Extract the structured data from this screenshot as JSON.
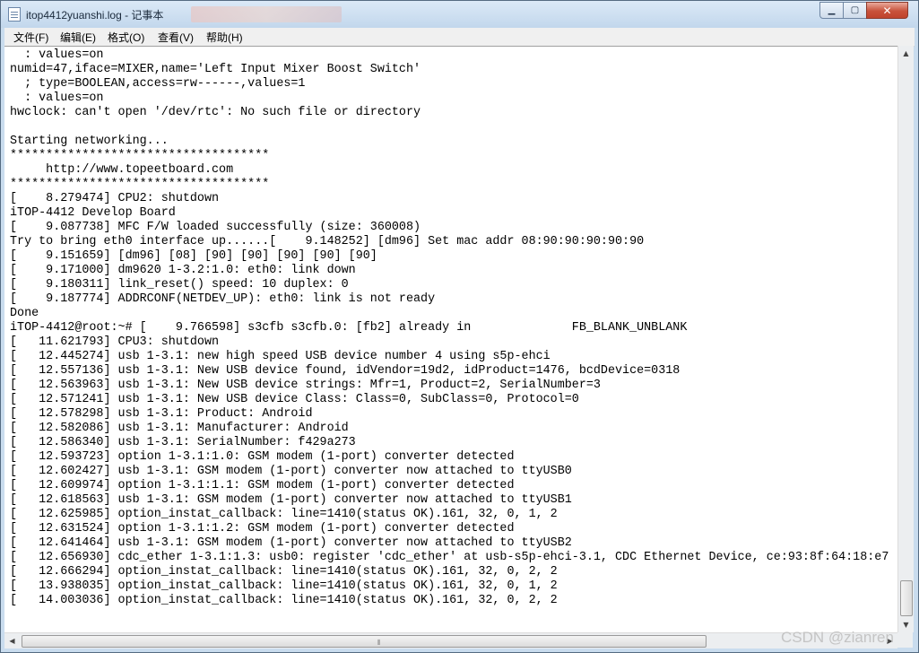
{
  "window": {
    "title": "itop4412yuanshi.log - 记事本",
    "controls": {
      "minimize": "▁",
      "maximize": "▢",
      "close": "✕"
    }
  },
  "menu": [
    {
      "label": "文件(F)"
    },
    {
      "label": "编辑(E)"
    },
    {
      "label": "格式(O)"
    },
    {
      "label": "查看(V)"
    },
    {
      "label": "帮助(H)"
    }
  ],
  "editor": {
    "lines": [
      "  : values=on",
      "numid=47,iface=MIXER,name='Left Input Mixer Boost Switch'",
      "  ; type=BOOLEAN,access=rw------,values=1",
      "  : values=on",
      "hwclock: can't open '/dev/rtc': No such file or directory",
      "",
      "Starting networking...",
      "************************************",
      "     http://www.topeetboard.com",
      "************************************",
      "[    8.279474] CPU2: shutdown",
      "iTOP-4412 Develop Board",
      "[    9.087738] MFC F/W loaded successfully (size: 360008)",
      "Try to bring eth0 interface up......[    9.148252] [dm96] Set mac addr 08:90:90:90:90:90",
      "[    9.151659] [dm96] [08] [90] [90] [90] [90] [90]",
      "[    9.171000] dm9620 1-3.2:1.0: eth0: link down",
      "[    9.180311] link_reset() speed: 10 duplex: 0",
      "[    9.187774] ADDRCONF(NETDEV_UP): eth0: link is not ready",
      "Done",
      "iTOP-4412@root:~# [    9.766598] s3cfb s3cfb.0: [fb2] already in              FB_BLANK_UNBLANK",
      "[   11.621793] CPU3: shutdown",
      "[   12.445274] usb 1-3.1: new high speed USB device number 4 using s5p-ehci",
      "[   12.557136] usb 1-3.1: New USB device found, idVendor=19d2, idProduct=1476, bcdDevice=0318",
      "[   12.563963] usb 1-3.1: New USB device strings: Mfr=1, Product=2, SerialNumber=3",
      "[   12.571241] usb 1-3.1: New USB device Class: Class=0, SubClass=0, Protocol=0",
      "[   12.578298] usb 1-3.1: Product: Android",
      "[   12.582086] usb 1-3.1: Manufacturer: Android",
      "[   12.586340] usb 1-3.1: SerialNumber: f429a273",
      "[   12.593723] option 1-3.1:1.0: GSM modem (1-port) converter detected",
      "[   12.602427] usb 1-3.1: GSM modem (1-port) converter now attached to ttyUSB0",
      "[   12.609974] option 1-3.1:1.1: GSM modem (1-port) converter detected",
      "[   12.618563] usb 1-3.1: GSM modem (1-port) converter now attached to ttyUSB1",
      "[   12.625985] option_instat_callback: line=1410(status OK).161, 32, 0, 1, 2",
      "[   12.631524] option 1-3.1:1.2: GSM modem (1-port) converter detected",
      "[   12.641464] usb 1-3.1: GSM modem (1-port) converter now attached to ttyUSB2",
      "[   12.656930] cdc_ether 1-3.1:1.3: usb0: register 'cdc_ether' at usb-s5p-ehci-3.1, CDC Ethernet Device, ce:93:8f:64:18:e7",
      "[   12.666294] option_instat_callback: line=1410(status OK).161, 32, 0, 2, 2",
      "[   13.938035] option_instat_callback: line=1410(status OK).161, 32, 0, 1, 2",
      "[   14.003036] option_instat_callback: line=1410(status OK).161, 32, 0, 2, 2"
    ]
  },
  "scrollbars": {
    "up_arrow": "▲",
    "down_arrow": "▼",
    "left_arrow": "◀",
    "right_arrow": "▶",
    "grip": "⦀"
  },
  "watermark": "CSDN @zianren"
}
